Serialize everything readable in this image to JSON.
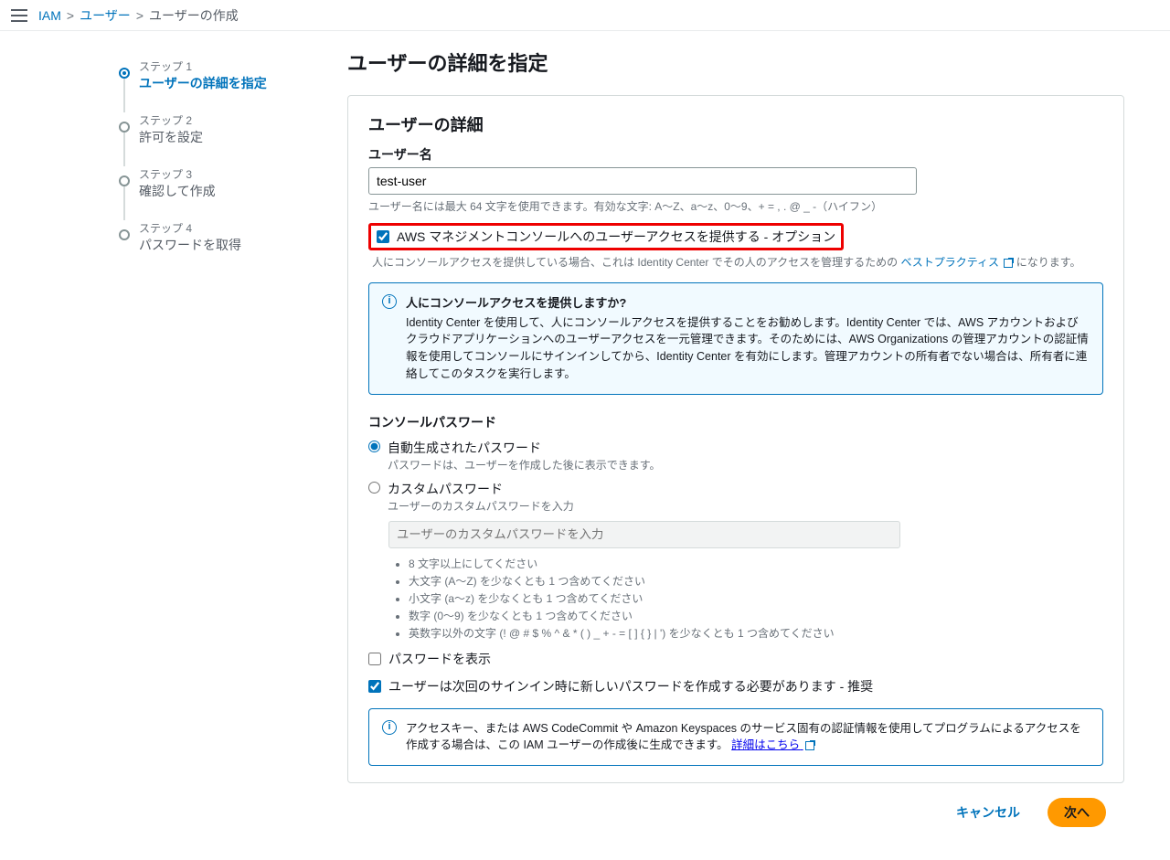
{
  "breadcrumb": {
    "iam": "IAM",
    "users": "ユーザー",
    "create": "ユーザーの作成"
  },
  "stepper": {
    "step1_label": "ステップ 1",
    "step1_title": "ユーザーの詳細を指定",
    "step2_label": "ステップ 2",
    "step2_title": "許可を設定",
    "step3_label": "ステップ 3",
    "step3_title": "確認して作成",
    "step4_label": "ステップ 4",
    "step4_title": "パスワードを取得"
  },
  "pageTitle": "ユーザーの詳細を指定",
  "panelTitle": "ユーザーの詳細",
  "username": {
    "label": "ユーザー名",
    "value": "test-user",
    "help": "ユーザー名には最大 64 文字を使用できます。有効な文字: A～Z、a～z、0～9、+ = , . @ _ -（ハイフン）"
  },
  "consoleAccess": {
    "label": "AWS マネジメントコンソールへのユーザーアクセスを提供する - オプション",
    "help_prefix": "人にコンソールアクセスを提供している場合、これは Identity Center でその人のアクセスを管理するための ",
    "help_link": "ベストプラクティス",
    "help_suffix": " になります。"
  },
  "infoBox1": {
    "title": "人にコンソールアクセスを提供しますか?",
    "body": "Identity Center を使用して、人にコンソールアクセスを提供することをお勧めします。Identity Center では、AWS アカウントおよびクラウドアプリケーションへのユーザーアクセスを一元管理できます。そのためには、AWS Organizations の管理アカウントの認証情報を使用してコンソールにサインインしてから、Identity Center を有効にします。管理アカウントの所有者でない場合は、所有者に連絡してこのタスクを実行します。"
  },
  "password": {
    "sectionTitle": "コンソールパスワード",
    "autoLabel": "自動生成されたパスワード",
    "autoHelp": "パスワードは、ユーザーを作成した後に表示できます。",
    "customLabel": "カスタムパスワード",
    "customPlaceholder": "ユーザーのカスタムパスワードを入力",
    "rules": [
      "8 文字以上にしてください",
      "大文字 (A～Z) を少なくとも 1 つ含めてください",
      "小文字 (a～z) を少なくとも 1 つ含めてください",
      "数字 (0～9) を少なくとも 1 つ含めてください",
      "英数字以外の文字 (! @ # $ % ^ & * ( ) _ + - = [ ] { } | ') を少なくとも 1 つ含めてください"
    ],
    "showPassword": "パスワードを表示",
    "mustReset": "ユーザーは次回のサインイン時に新しいパスワードを作成する必要があります - 推奨"
  },
  "infoBox2": {
    "body_prefix": "アクセスキー、または AWS CodeCommit や Amazon Keyspaces のサービス固有の認証情報を使用してプログラムによるアクセスを作成する場合は、この IAM ユーザーの作成後に生成できます。 ",
    "link": "詳細はこちら"
  },
  "footer": {
    "cancel": "キャンセル",
    "next": "次へ"
  }
}
